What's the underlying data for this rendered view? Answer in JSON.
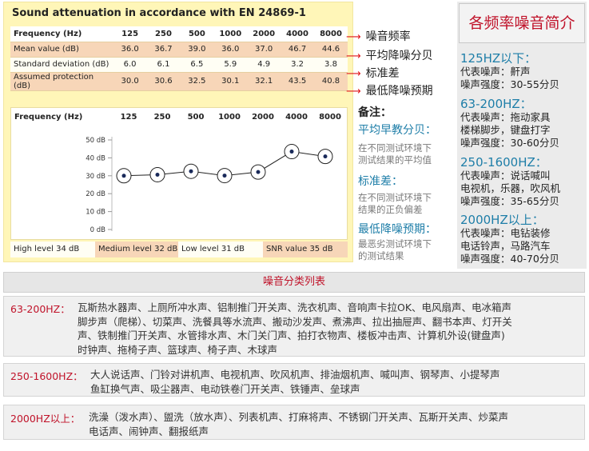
{
  "panel_title": "Sound attenuation in accordance with  EN 24869-1",
  "table": {
    "header_label": "Frequency (Hz)",
    "frequencies": [
      "125",
      "250",
      "500",
      "1000",
      "2000",
      "4000",
      "8000"
    ],
    "rows": [
      {
        "label": "Mean value (dB)",
        "values": [
          "36.0",
          "36.7",
          "39.0",
          "36.0",
          "37.0",
          "46.7",
          "44.6"
        ]
      },
      {
        "label": "Standard deviation (dB)",
        "values": [
          "6.0",
          "6.1",
          "6.5",
          "5.9",
          "4.9",
          "3.2",
          "3.8"
        ]
      },
      {
        "label": "Assumed protection (dB)",
        "values": [
          "30.0",
          "30.6",
          "32.5",
          "30.1",
          "32.1",
          "43.5",
          "40.8"
        ]
      }
    ]
  },
  "annotations": [
    "噪音频率",
    "平均降噪分贝",
    "标准差",
    "最低降噪预期"
  ],
  "chart_data": {
    "type": "line",
    "header_label": "Frequency (Hz)",
    "categories": [
      "125",
      "250",
      "500",
      "1000",
      "2000",
      "4000",
      "8000"
    ],
    "series": [
      {
        "values": [
          30.0,
          30.6,
          32.5,
          30.1,
          32.1,
          43.5,
          40.8
        ]
      }
    ],
    "ytick_labels": [
      "50 dB",
      "40 dB",
      "30 dB",
      "20 dB",
      "10 dB",
      "0 dB"
    ],
    "yticks": [
      50,
      40,
      30,
      20,
      10,
      0
    ],
    "ylim": [
      0,
      50
    ],
    "grid": false
  },
  "levels": [
    "High level 34 dB",
    "Medium level 32 dB",
    "Low level 31 dB",
    "SNR value 35 dB"
  ],
  "notes": {
    "title": "备注：",
    "items": [
      {
        "heading": "平均早教分贝：",
        "text": [
          "在不同测试环境下",
          "测试结果的平均值"
        ]
      },
      {
        "heading": "标准差：",
        "text": [
          "在不同测试环境下",
          "结果的正负偏差"
        ]
      },
      {
        "heading": "最低降噪预期：",
        "text": [
          "最恶劣测试环境下",
          "的测试结果"
        ]
      }
    ]
  },
  "right_panel": {
    "title": "各频率噪音简介",
    "sections": [
      {
        "heading": "125HZ以下：",
        "lines": [
          "代表噪声：鼾声",
          "噪声强度：30-55分贝"
        ]
      },
      {
        "heading": "63-200HZ：",
        "lines": [
          "代表噪声：拖动家具",
          "楼梯脚步，键盘打字",
          "噪声强度：30-60分贝"
        ]
      },
      {
        "heading": "250-1600HZ：",
        "lines": [
          "代表噪声：说话喊叫",
          "电视机，乐器，吹风机",
          "噪声强度：35-65分贝"
        ]
      },
      {
        "heading": "2000HZ以上：",
        "lines": [
          "代表噪声：电钻装修",
          "电话铃声，马路汽车",
          "噪声强度：40-70分贝"
        ]
      }
    ]
  },
  "categories": {
    "title": "噪音分类列表",
    "groups": [
      {
        "label": "63-200HZ：",
        "lines": [
          "瓦斯热水器声、上厕所冲水声、铝制推门开关声、洗衣机声、音响声卡拉OK、电风扇声、电冰箱声",
          "脚步声（爬梯）、切菜声、洗餐具等水流声、搬动沙发声、煮沸声、拉出抽屉声、翻书本声、灯开关",
          "声、铁制推门开关声、水管排水声、木门关门声、拍打衣物声、楼板冲击声、计算机外设(键盘声)",
          "时钟声、拖椅子声、篮球声、椅子声、木球声"
        ]
      },
      {
        "label": "250-1600HZ：",
        "lines": [
          "大人说话声、门铃对讲机声、电视机声、吹风机声、排油烟机声、喊叫声、钢琴声、小提琴声",
          "鱼缸换气声、吸尘器声、电动铁卷门开关声、铁锤声、垒球声"
        ]
      },
      {
        "label": "2000HZ以上：",
        "lines": [
          "洗澡（泼水声）、盥洗（放水声）、列表机声、打麻将声、不锈钢门开关声、瓦斯开关声、炒菜声",
          "电话声、闹钟声、翻报纸声"
        ]
      }
    ]
  }
}
